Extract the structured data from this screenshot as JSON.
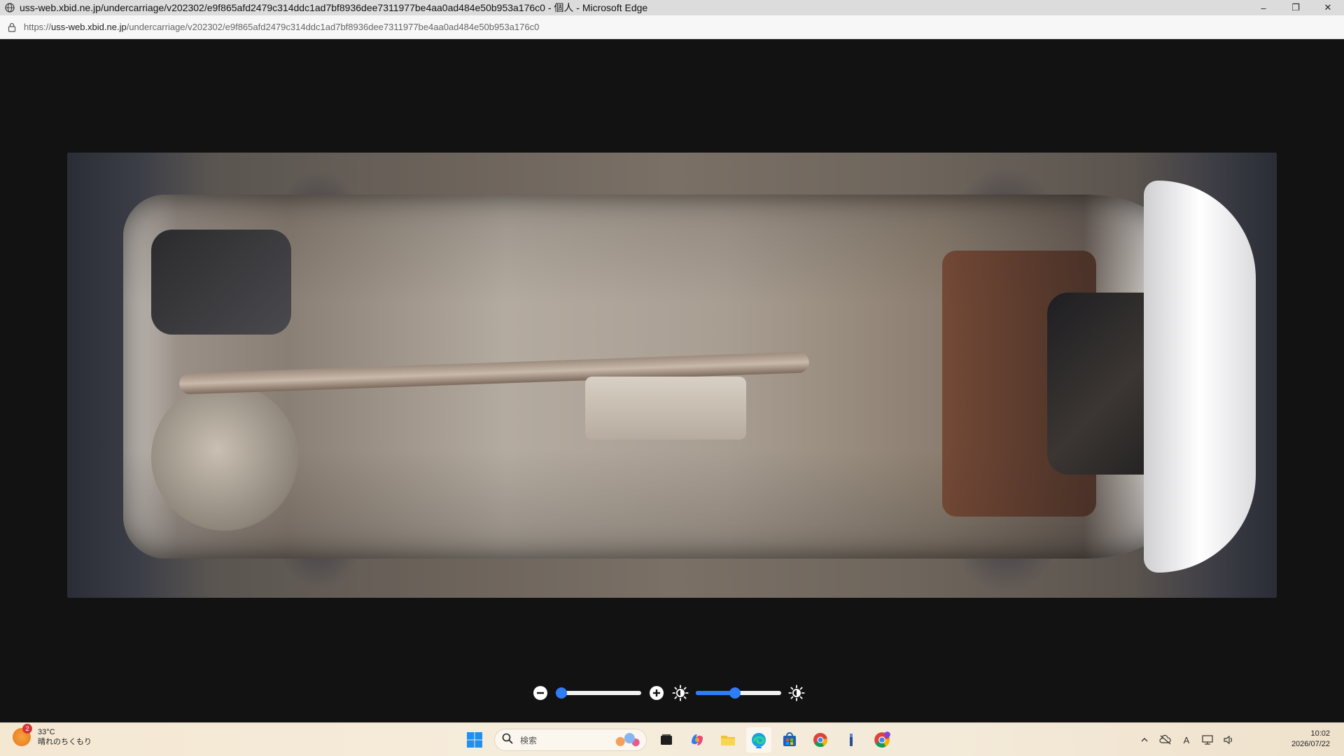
{
  "window": {
    "title": "uss-web.xbid.ne.jp/undercarriage/v202302/e9f865afd2479c314ddc1ad7bf8936dee7311977be4aa0ad484e50b953a176c0 - 個人 - Microsoft Edge",
    "controls": {
      "minimize": "–",
      "restore": "❐",
      "close": "✕"
    }
  },
  "address_bar": {
    "url_prefix": "https://",
    "url_host": "uss-web.xbid.ne.jp",
    "url_path": "/undercarriage/v202302/e9f865afd2479c314ddc1ad7bf8936dee7311977be4aa0ad484e50b953a176c0"
  },
  "viewer": {
    "image_alt": "undercarriage photo",
    "zoom_level": 0.0,
    "brightness_level": 0.46
  },
  "taskbar": {
    "weather": {
      "badge": "2",
      "temp": "33°C",
      "condition": "晴れのちくもり"
    },
    "search_placeholder": "検索",
    "clock": {
      "time": "10:02",
      "date": "2026/07/22"
    },
    "tray": {
      "ime": "A"
    }
  },
  "colors": {
    "accent": "#2f7df6",
    "viewer_bg": "#121212"
  }
}
